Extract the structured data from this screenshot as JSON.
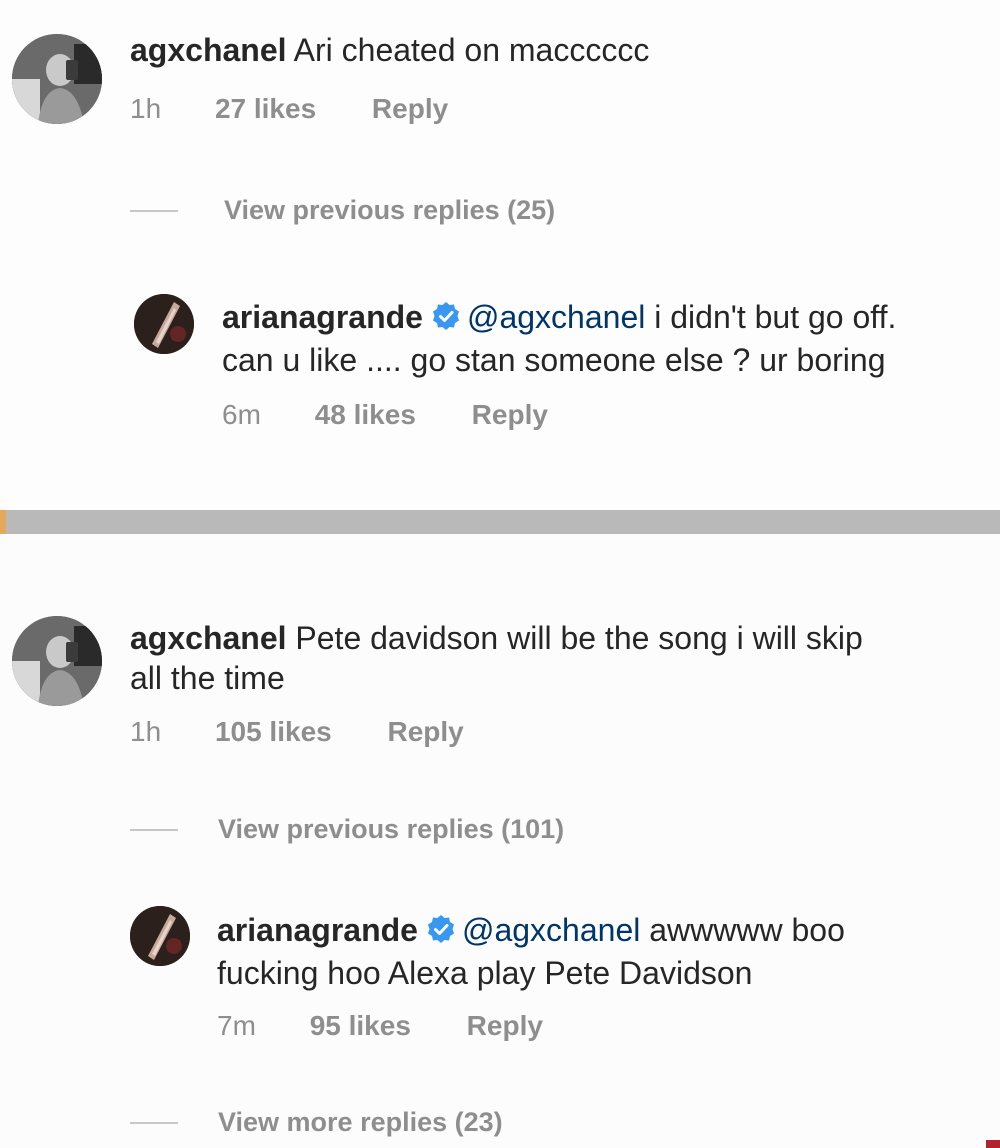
{
  "colors": {
    "text": "#262626",
    "meta": "#8e8e8e",
    "mention": "#003569",
    "verified": "#3897f0",
    "divider": "#b9b9b9"
  },
  "threads": [
    {
      "comment": {
        "avatar_icon": "user-avatar-icon",
        "username": "agxchanel",
        "text": "Ari cheated on macccccc",
        "time": "1h",
        "likes": "27 likes",
        "reply": "Reply"
      },
      "view_previous": "View previous replies (25)",
      "reply": {
        "avatar_icon": "verified-user-avatar-icon",
        "username": "arianagrande",
        "verified_icon": "verified-badge-icon",
        "mention": "@agxchanel",
        "line1_text": "i didn't but go off.",
        "line2_text": "can u like .... go stan someone else ? ur boring",
        "time": "6m",
        "likes": "48 likes",
        "reply": "Reply"
      }
    },
    {
      "comment": {
        "avatar_icon": "user-avatar-icon",
        "username": "agxchanel",
        "line1_text": "Pete davidson will be the song i will skip",
        "line2_text": "all the time",
        "time": "1h",
        "likes": "105 likes",
        "reply": "Reply"
      },
      "view_previous": "View previous replies (101)",
      "reply": {
        "avatar_icon": "verified-user-avatar-icon",
        "username": "arianagrande",
        "verified_icon": "verified-badge-icon",
        "mention": "@agxchanel",
        "line1_text": "awwwww boo",
        "line2_text": "fucking hoo Alexa play Pete Davidson",
        "time": "7m",
        "likes": "95 likes",
        "reply": "Reply"
      },
      "view_more": "View more replies (23)"
    }
  ]
}
